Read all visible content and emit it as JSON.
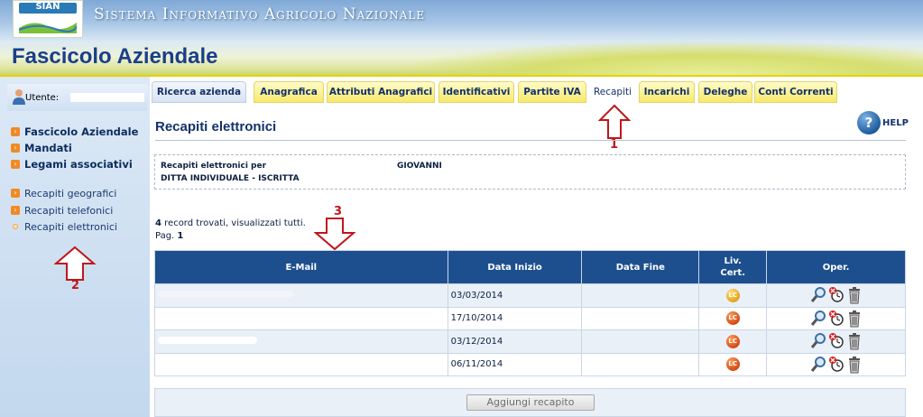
{
  "header": {
    "logo_text": "SIAN",
    "system_title": "Sistema Informativo Agricolo Nazionale",
    "app_title": "Fascicolo Aziendale"
  },
  "sidebar": {
    "user_label": "Utente:",
    "groups": [
      {
        "label": "Fascicolo Aziendale",
        "icon": "orange-arrow-icon"
      },
      {
        "label": "Mandati",
        "icon": "orange-arrow-icon"
      },
      {
        "label": "Legami associativi",
        "icon": "orange-arrow-icon"
      }
    ],
    "links": [
      {
        "label": "Recapiti geografici",
        "icon": "orange-arrow-icon"
      },
      {
        "label": "Recapiti telefonici",
        "icon": "orange-arrow-icon"
      },
      {
        "label": "Recapiti elettronici",
        "icon": "dot-icon"
      }
    ]
  },
  "tabs": [
    {
      "label": "Ricerca azienda"
    },
    {
      "label": "Anagrafica"
    },
    {
      "label": "Attributi Anagrafici"
    },
    {
      "label": "Identificativi"
    },
    {
      "label": "Partite IVA"
    },
    {
      "label": "Recapiti",
      "active": true
    },
    {
      "label": "Incarichi"
    },
    {
      "label": "Deleghe"
    },
    {
      "label": "Conti Correnti"
    }
  ],
  "annotations": {
    "n1": "1",
    "n2": "2",
    "n3": "3",
    "color": "#c0161b"
  },
  "main": {
    "section_title": "Recapiti elettronici",
    "help_label": "HELP",
    "info": {
      "line1_label": "Recapiti elettronici per",
      "line1_name": "GIOVANNI",
      "line2": "DITTA INDIVIDUALE - ISCRITTA"
    },
    "records_count": "4",
    "records_text": " record trovati, visualizzati tutti.",
    "page_label": "Pag. ",
    "page_number": "1",
    "table": {
      "headers": [
        "E-Mail",
        "Data Inizio",
        "Data Fine",
        "Liv. Cert.",
        "Oper."
      ],
      "rows": [
        {
          "data_inizio": "03/03/2014",
          "data_fine": "",
          "liv_cert": "LC",
          "cert_color": "yellow"
        },
        {
          "data_inizio": "17/10/2014",
          "data_fine": "",
          "liv_cert": "LC",
          "cert_color": "orange"
        },
        {
          "data_inizio": "03/12/2014",
          "data_fine": "",
          "liv_cert": "LC",
          "cert_color": "orange"
        },
        {
          "data_inizio": "06/11/2014",
          "data_fine": "",
          "liv_cert": "LC",
          "cert_color": "orange"
        }
      ],
      "ops_icons": [
        "magnifier-icon",
        "close-clock-icon",
        "trash-icon"
      ]
    },
    "add_button": "Aggiungi recapito"
  }
}
